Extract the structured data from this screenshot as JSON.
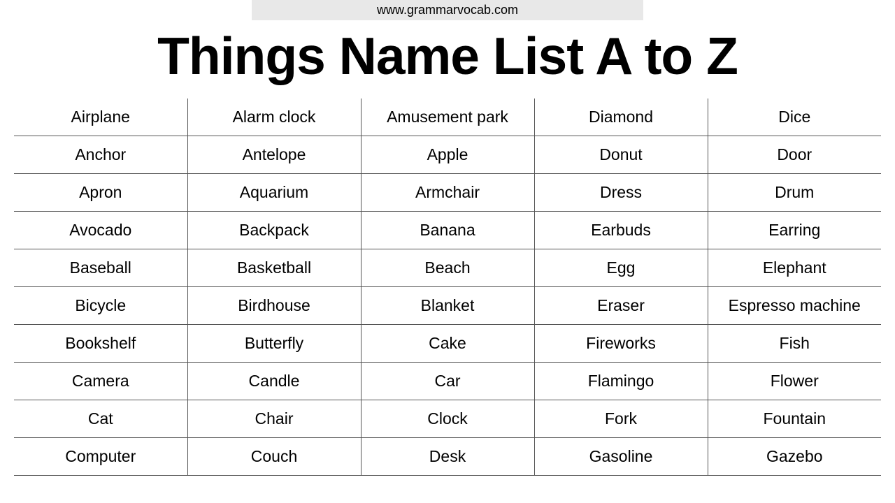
{
  "header": {
    "site": "www.grammarvocab.com"
  },
  "title": "Things Name List A to Z",
  "table": {
    "rows": [
      [
        "Airplane",
        "Alarm clock",
        "Amusement park",
        "Diamond",
        "Dice"
      ],
      [
        "Anchor",
        "Antelope",
        "Apple",
        "Donut",
        "Door"
      ],
      [
        "Apron",
        "Aquarium",
        "Armchair",
        "Dress",
        "Drum"
      ],
      [
        "Avocado",
        "Backpack",
        "Banana",
        "Earbuds",
        "Earring"
      ],
      [
        "Baseball",
        "Basketball",
        "Beach",
        "Egg",
        "Elephant"
      ],
      [
        "Bicycle",
        "Birdhouse",
        "Blanket",
        "Eraser",
        "Espresso machine"
      ],
      [
        "Bookshelf",
        "Butterfly",
        "Cake",
        "Fireworks",
        "Fish"
      ],
      [
        "Camera",
        "Candle",
        "Car",
        "Flamingo",
        "Flower"
      ],
      [
        "Cat",
        "Chair",
        "Clock",
        "Fork",
        "Fountain"
      ],
      [
        "Computer",
        "Couch",
        "Desk",
        "Gasoline",
        "Gazebo"
      ]
    ]
  }
}
